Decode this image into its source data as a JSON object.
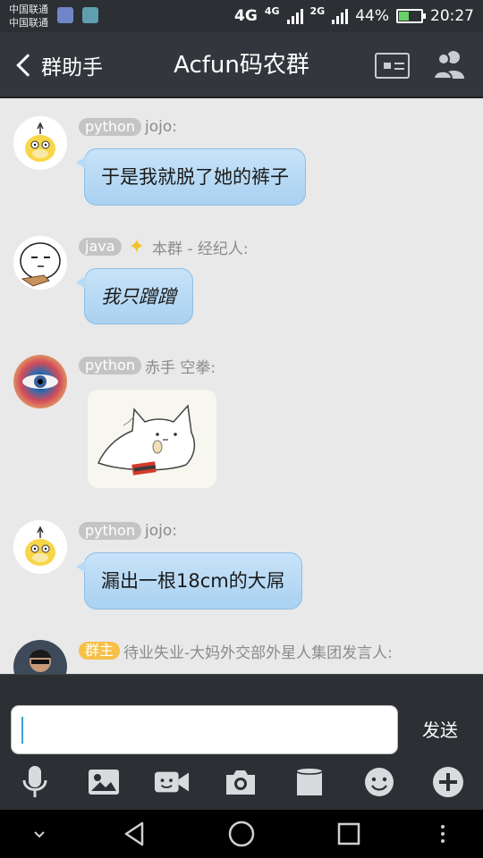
{
  "status_bar": {
    "carrier_1": "中国联通",
    "carrier_2": "中国联通",
    "network_1": "4G",
    "network_2": "4G",
    "network_3": "2G",
    "battery": "44%",
    "battery_level": 0.44,
    "time": "20:27"
  },
  "header": {
    "back_label": "群助手",
    "title": "Acfun码农群"
  },
  "messages": [
    {
      "tag": "python",
      "sender": "jojo:",
      "text": "于是我就脱了她的裤子"
    },
    {
      "tag": "java",
      "sender": "本群 - 经纪人:",
      "text": "我只蹭蹭"
    },
    {
      "tag": "python",
      "sender": "赤手 空拳:",
      "sticker": "cat-sticker"
    },
    {
      "tag": "python",
      "sender": "jojo:",
      "text": "漏出一根18cm的大屌"
    },
    {
      "tag": "群主",
      "sender": "待业失业-大妈外交部外星人集团发言人:"
    }
  ],
  "input": {
    "value": "",
    "send_label": "发送"
  },
  "toolbar": [
    "microphone-icon",
    "image-icon",
    "video-icon",
    "camera-icon",
    "file-icon",
    "emoji-icon",
    "plus-icon"
  ],
  "colors": {
    "bubble": "#b9daf4",
    "chat_bg": "#e9e9e9",
    "bar_dark": "#2c2f33",
    "owner_tag": "#f6c046"
  }
}
